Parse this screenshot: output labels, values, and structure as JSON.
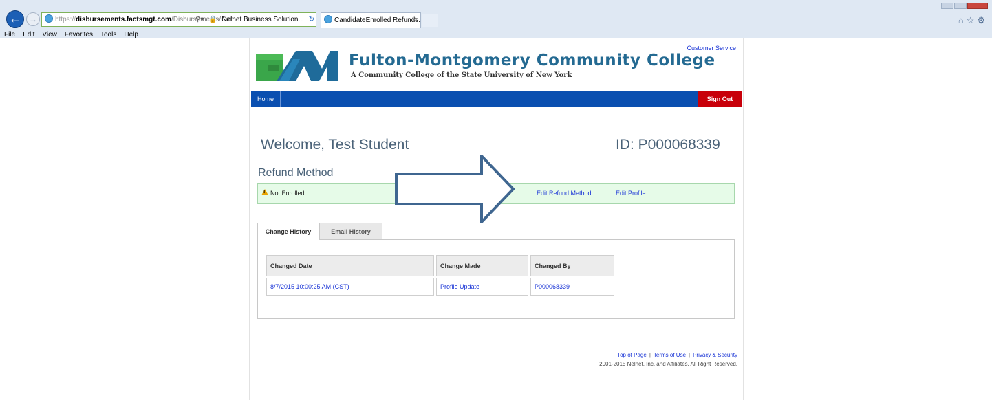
{
  "browser": {
    "url_scheme": "https://",
    "url_domain": "disbursements.factsmgt.com",
    "url_path": "/Disbursements/Can",
    "cert_label": "Nelnet Business Solution...",
    "tab_title": "CandidateEnrolled Refunds...",
    "menu": [
      "File",
      "Edit",
      "View",
      "Favorites",
      "Tools",
      "Help"
    ]
  },
  "header": {
    "college_name": "Fulton-Montgomery Community College",
    "college_subtitle": "A Community College of the State University of New York",
    "customer_service": "Customer Service",
    "brand_green": "#3aa64a",
    "brand_blue": "#1f6b9a"
  },
  "nav": {
    "home": "Home",
    "sign_out": "Sign Out",
    "bar_color": "#0a4fb0",
    "signout_color": "#c8000a"
  },
  "main": {
    "welcome": "Welcome, Test Student",
    "student_id": "ID: P000068339"
  },
  "refund": {
    "title": "Refund Method",
    "status": "Not Enrolled",
    "edit_refund_method": "Edit Refund Method",
    "edit_profile": "Edit Profile"
  },
  "history": {
    "tabs": [
      "Change History",
      "Email History"
    ],
    "active_tab": "Change History",
    "columns": [
      "Changed Date",
      "Change Made",
      "Changed By"
    ],
    "rows": [
      [
        "8/7/2015 10:00:25 AM (CST)",
        "Profile Update",
        "P000068339"
      ]
    ]
  },
  "footer": {
    "top_of_page": "Top of Page",
    "terms": "Terms of Use",
    "privacy": "Privacy & Security",
    "copyright": "2001-2015 Nelnet, Inc. and Affiliates. All Right Reserved."
  }
}
